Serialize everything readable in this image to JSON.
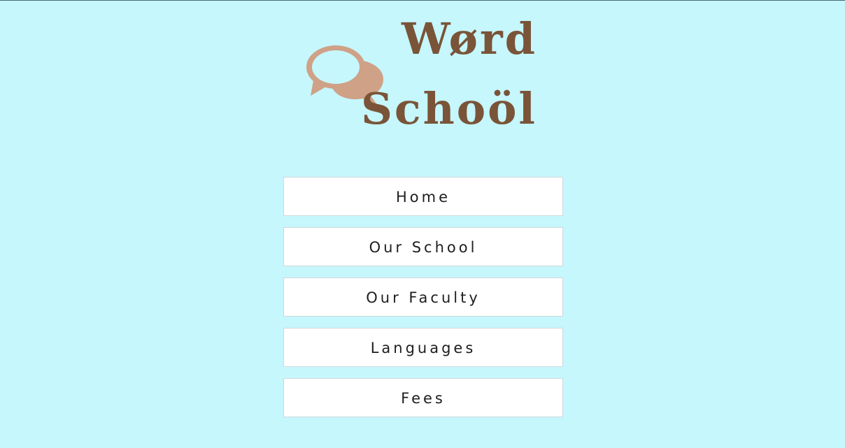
{
  "brand": {
    "line1": "Wørd",
    "line2": "Schoöl",
    "icon": "chat-bubbles-icon",
    "color": "#7a5438",
    "icon_color": "#cfa186"
  },
  "nav": {
    "items": [
      {
        "label": "Home"
      },
      {
        "label": "Our School"
      },
      {
        "label": "Our Faculty"
      },
      {
        "label": "Languages"
      },
      {
        "label": "Fees"
      }
    ]
  },
  "colors": {
    "background": "#c5f7fd",
    "button": "#ffffff",
    "button_text": "#1e1e1e"
  }
}
